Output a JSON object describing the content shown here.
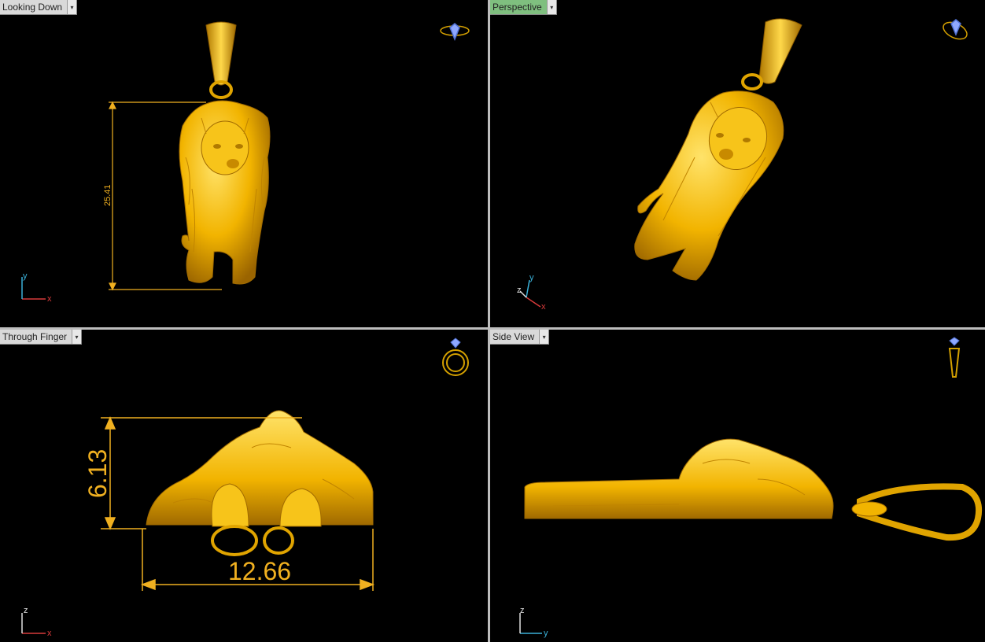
{
  "viewports": {
    "top_left": {
      "label": "Looking Down",
      "dimension": "25.41",
      "axes": {
        "vertical": "y",
        "horizontal": "x"
      }
    },
    "top_right": {
      "label": "Perspective",
      "axes": {
        "vertical": "y",
        "depth": "z",
        "horizontal": "x"
      }
    },
    "bottom_left": {
      "label": "Through Finger",
      "dimension_height": "6.13",
      "dimension_width": "12.66",
      "axes": {
        "vertical": "z",
        "horizontal": "x"
      }
    },
    "bottom_right": {
      "label": "Side View",
      "axes": {
        "vertical": "z",
        "horizontal": "y"
      }
    }
  },
  "dropdown_glyph": "▾",
  "colors": {
    "gold": "#f2b400",
    "gold_dark": "#a86f00",
    "dimension": "#f0b020",
    "active_label": "#7fbf7f",
    "axis_x": "#d83a3a",
    "axis_y": "#3ab0d8",
    "axis_z": "#e0e0e0"
  }
}
